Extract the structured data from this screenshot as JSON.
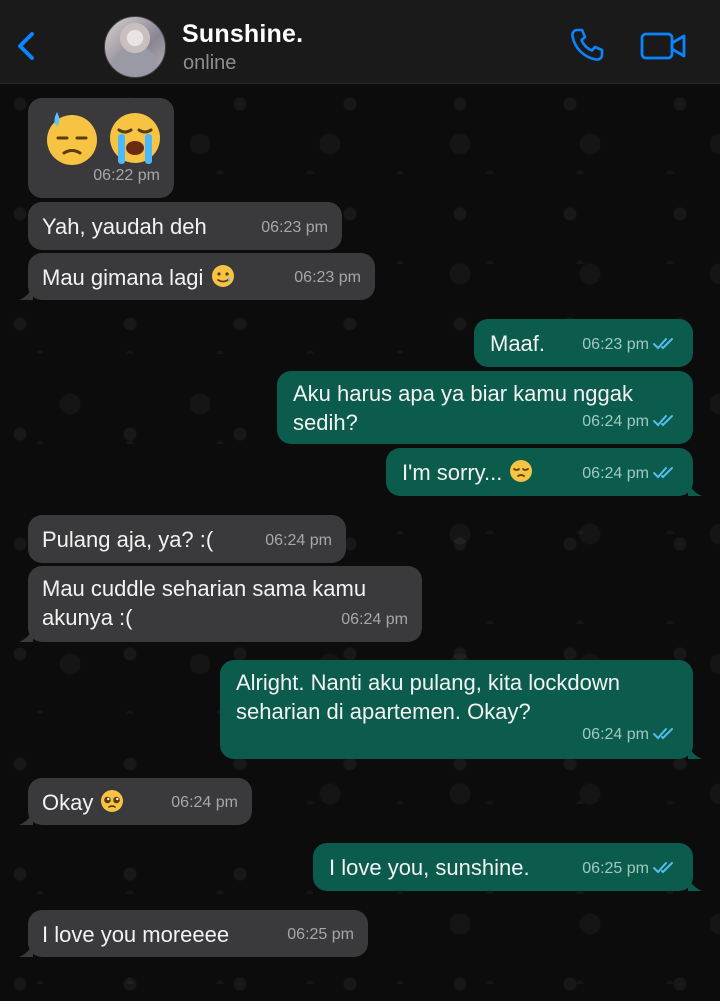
{
  "header": {
    "back": "back",
    "contact_name": "Sunshine.",
    "status": "online",
    "icons": {
      "back": "chevron-left-icon",
      "call": "phone-icon",
      "video": "video-camera-icon"
    },
    "accent_color": "#0a84ff"
  },
  "colors": {
    "incoming_bubble": "#3a3a3c",
    "outgoing_bubble": "#0b5c4c",
    "read_tick": "#53bdeb"
  },
  "messages": [
    {
      "dir": "in",
      "text": "",
      "emojis": [
        "downcast-sweat-emoji",
        "loudly-crying-emoji"
      ],
      "time": "06:22 pm"
    },
    {
      "dir": "in",
      "text": "Yah, yaudah deh",
      "time": "06:23 pm"
    },
    {
      "dir": "in",
      "text": "Mau gimana lagi",
      "emoji": "tear-smile-emoji",
      "time": "06:23 pm"
    },
    {
      "dir": "out",
      "text": "Maaf.",
      "time": "06:23 pm",
      "status": "read"
    },
    {
      "dir": "out",
      "text": "Aku harus apa ya biar kamu nggak sedih?",
      "time": "06:24 pm",
      "status": "read"
    },
    {
      "dir": "out",
      "text": "I'm sorry...",
      "emoji": "pensive-emoji",
      "time": "06:24 pm",
      "status": "read"
    },
    {
      "dir": "in",
      "text": "Pulang aja, ya? :(",
      "time": "06:24 pm"
    },
    {
      "dir": "in",
      "text": "Mau cuddle seharian sama kamu akunya :(",
      "time": "06:24 pm"
    },
    {
      "dir": "out",
      "text": "Alright. Nanti aku pulang, kita lockdown seharian di apartemen. Okay?",
      "time": "06:24 pm",
      "status": "read"
    },
    {
      "dir": "in",
      "text": "Okay",
      "emoji": "pleading-emoji",
      "time": "06:24 pm"
    },
    {
      "dir": "out",
      "text": "I love you, sunshine.",
      "time": "06:25 pm",
      "status": "read"
    },
    {
      "dir": "in",
      "text": "I love you moreeee",
      "time": "06:25 pm"
    }
  ]
}
